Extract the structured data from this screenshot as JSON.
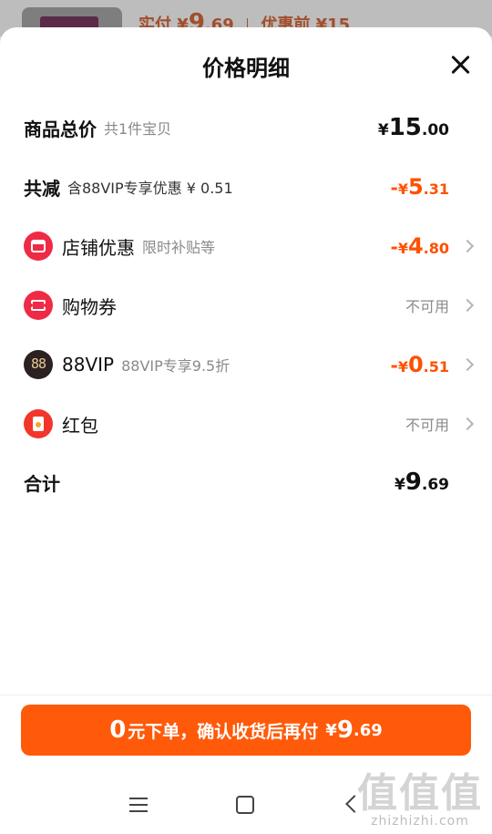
{
  "background_peek": {
    "paid_label": "实付",
    "paid_yen": "¥",
    "paid_int": "9",
    "paid_dec": ".69",
    "before_discount": "优惠前 ¥15"
  },
  "sheet": {
    "title": "价格明细"
  },
  "rows": {
    "total": {
      "label": "商品总价",
      "sub": "共1件宝贝",
      "yen": "¥",
      "int": "15",
      "dec": ".00"
    },
    "reduction": {
      "label": "共减",
      "sub": "含88VIP专享优惠 ¥ 0.51",
      "minus": "-",
      "yen": "¥",
      "int": "5",
      "dec": ".31"
    },
    "store": {
      "label": "店铺优惠",
      "sub": "限时补贴等",
      "minus": "-",
      "yen": "¥",
      "int": "4",
      "dec": ".80",
      "icon": "store-icon"
    },
    "coupon": {
      "label": "购物券",
      "status": "不可用",
      "icon": "ticket-icon"
    },
    "vip": {
      "label": "88VIP",
      "sub": "88VIP专享9.5折",
      "minus": "-",
      "yen": "¥",
      "int": "0",
      "dec": ".51",
      "icon_text": "88",
      "icon": "vip-88-icon"
    },
    "redpacket": {
      "label": "红包",
      "status": "不可用",
      "icon": "red-envelope-icon"
    },
    "sum": {
      "label": "合计",
      "yen": "¥",
      "int": "9",
      "dec": ".69"
    }
  },
  "cta": {
    "zero": "0",
    "text": "元下单，确认收货后再付",
    "yen": "¥",
    "int": "9",
    "dec": ".69"
  },
  "watermark": {
    "logo": "值值值",
    "url": "zhizhizhi.com"
  },
  "colors": {
    "accent": "#ff5000",
    "cta_bg": "#ff5a0a",
    "icon_red": "#ef2a45",
    "vip_dark": "#2a2120"
  }
}
